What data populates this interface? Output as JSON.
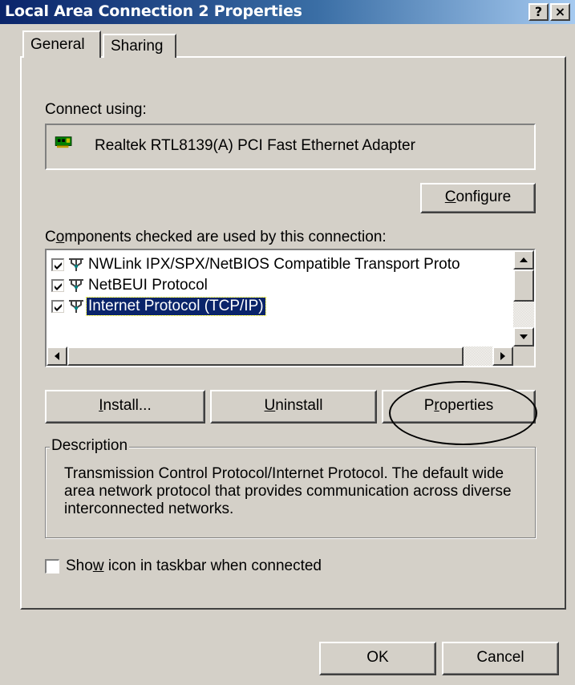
{
  "window": {
    "title": "Local Area Connection 2 Properties",
    "help_label": "?",
    "close_label": "×"
  },
  "tabs": [
    {
      "label": "General",
      "active": true
    },
    {
      "label": "Sharing",
      "active": false
    }
  ],
  "connect_using": {
    "label_prefix": "Connect using:",
    "adapter": "Realtek RTL8139(A) PCI Fast Ethernet Adapter",
    "adapter_icon": "network-card-icon"
  },
  "configure_button": {
    "accel": "C",
    "rest": "onfigure"
  },
  "components": {
    "label_pre": "C",
    "label_accel": "o",
    "label_post": "mponents checked are used by this connection:",
    "items": [
      {
        "label": "NWLink IPX/SPX/NetBIOS Compatible Transport Proto",
        "checked": true,
        "selected": false,
        "icon": "protocol-icon"
      },
      {
        "label": "NetBEUI Protocol",
        "checked": true,
        "selected": false,
        "icon": "protocol-icon"
      },
      {
        "label": "Internet Protocol (TCP/IP)",
        "checked": true,
        "selected": true,
        "icon": "protocol-icon"
      }
    ]
  },
  "action_buttons": {
    "install": {
      "accel": "I",
      "rest": "nstall..."
    },
    "uninstall": {
      "accel": "U",
      "rest": "ninstall"
    },
    "properties": {
      "pre": "P",
      "accel": "r",
      "rest": "operties"
    }
  },
  "description": {
    "legend": "Description",
    "text": "Transmission Control Protocol/Internet Protocol. The default wide area network protocol that provides communication across diverse interconnected networks."
  },
  "show_icon": {
    "pre": "Sho",
    "accel": "w",
    "rest": " icon in taskbar when connected",
    "checked": false
  },
  "footer": {
    "ok_label": "OK",
    "cancel_label": "Cancel"
  },
  "colors": {
    "face": "#d4d0c8",
    "titlebar_start": "#0a246a",
    "titlebar_end": "#a6caf0",
    "selection": "#0a246a"
  }
}
